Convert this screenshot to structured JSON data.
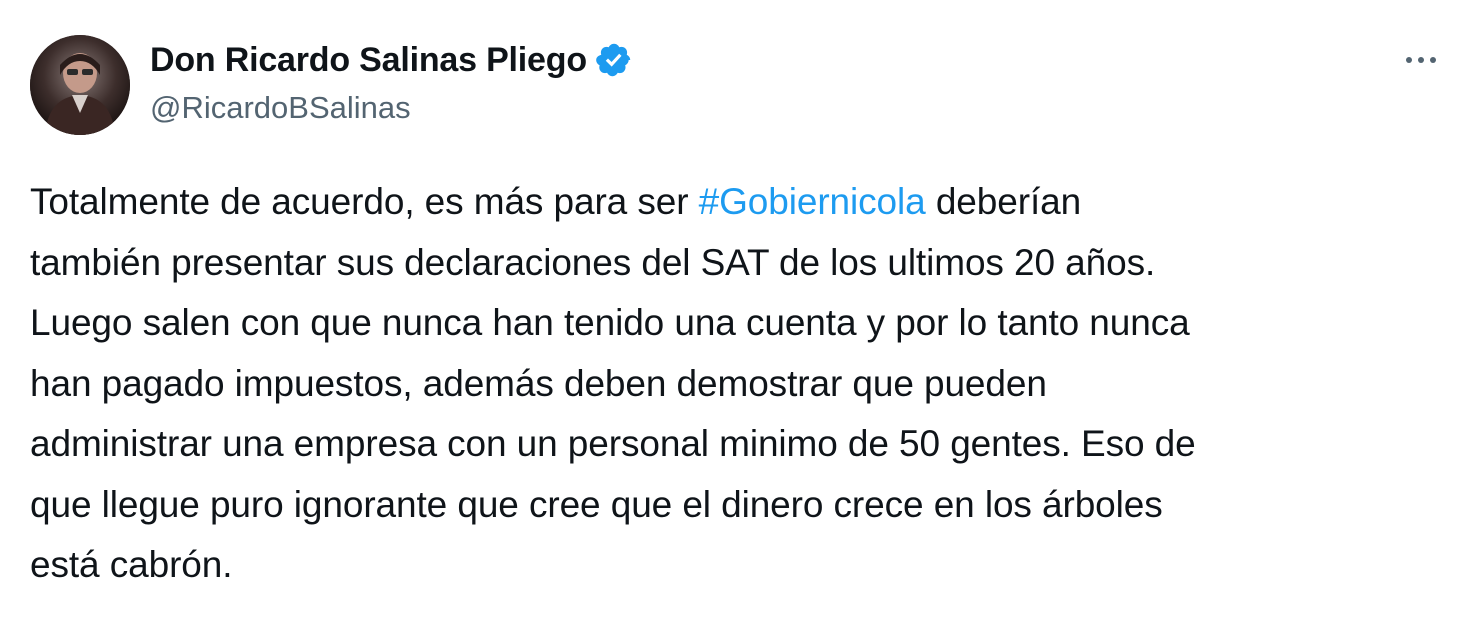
{
  "author": {
    "name": "Don Ricardo Salinas Pliego",
    "handle": "@RicardoBSalinas",
    "verified": true,
    "avatar_icon": "profile-photo"
  },
  "menu": {
    "more_label": "···",
    "icon": "more-horizontal-icon"
  },
  "tweet": {
    "text_before": "Totalmente de acuerdo, es más para ser ",
    "hashtag": "#Gobiernicola",
    "text_after": " deberían\ntambién presentar sus declaraciones del SAT de los ultimos 20 años.\nLuego salen con que nunca han tenido una cuenta y por lo tanto nunca\nhan pagado impuestos, además deben demostrar que pueden\nadministrar una empresa con un personal minimo de 50 gentes. Eso de\nque llegue puro ignorante que cree que el dinero crece en los árboles\nestá cabrón."
  },
  "colors": {
    "text": "#0f1419",
    "secondary": "#536471",
    "accent": "#1d9bf0"
  }
}
